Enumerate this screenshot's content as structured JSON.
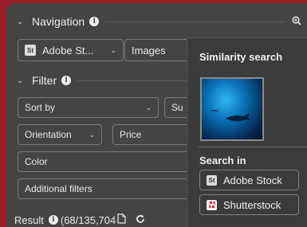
{
  "navigation": {
    "title": "Navigation",
    "source_selected": "Adobe St...",
    "content_type": "Images"
  },
  "filter": {
    "title": "Filter",
    "sort_by": "Sort by",
    "sort_partial": "Su",
    "orientation": "Orientation",
    "price": "Price",
    "color": "Color",
    "additional_filters": "Additional filters"
  },
  "popover": {
    "title": "Similarity search",
    "search_in": "Search in",
    "sources": [
      "Adobe Stock",
      "Shutterstock"
    ]
  },
  "result": {
    "label": "Result",
    "count": "(68/135,704"
  },
  "colors": {
    "background": "#444444",
    "popover": "#3b3b3b",
    "outer": "#9a1e2c"
  }
}
